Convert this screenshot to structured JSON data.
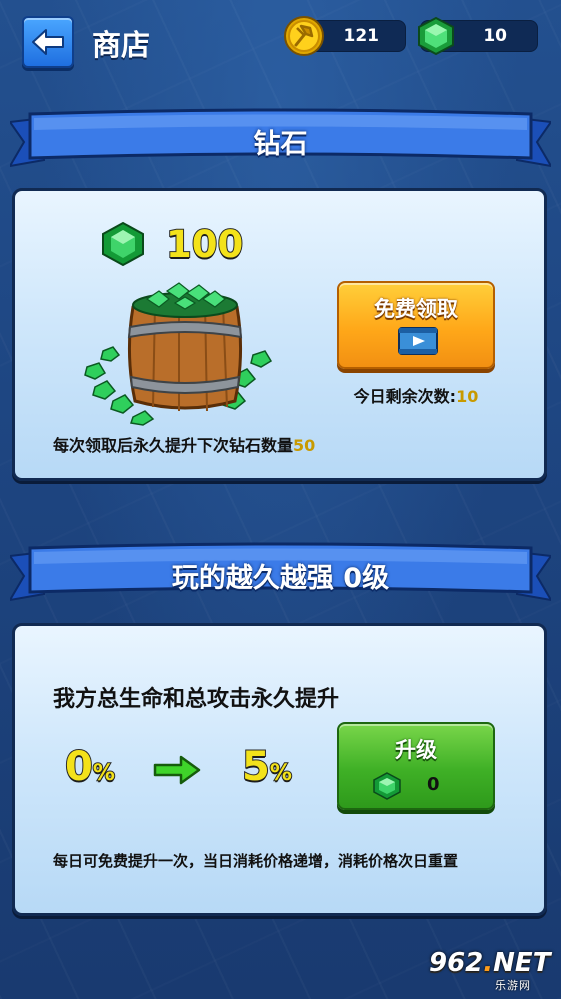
{
  "header": {
    "title": "商店",
    "gold": "121",
    "gems": "10"
  },
  "diamond_section": {
    "title": "钻石",
    "amount": "100",
    "claim_button": "免费领取",
    "remaining_label": "今日剩余次数:",
    "remaining_count": "10",
    "note_text": "每次领取后永久提升下次钻石数量",
    "note_value": "50"
  },
  "upgrade_section": {
    "title": "玩的越久越强 0级",
    "description": "我方总生命和总攻击永久提升",
    "from_value": "0",
    "to_value": "5",
    "percent_sign": "%",
    "upgrade_button": "升级",
    "cost": "0",
    "note": "每日可免费提升一次，当日消耗价格递增，消耗价格次日重置"
  },
  "watermark": {
    "brand_a": "962",
    "brand_dot": ".",
    "brand_b": "NET",
    "sub": "乐游网"
  },
  "colors": {
    "background": "#1d3f79",
    "accent_yellow": "#f3e21a",
    "claim_orange": "#ffa819",
    "upgrade_green": "#3fb026",
    "gem_green": "#25c24a"
  },
  "icons": [
    "back-arrow-icon",
    "gold-coin-icon",
    "gem-icon",
    "diamond-barrel-icon",
    "video-icon",
    "green-arrow-icon"
  ]
}
